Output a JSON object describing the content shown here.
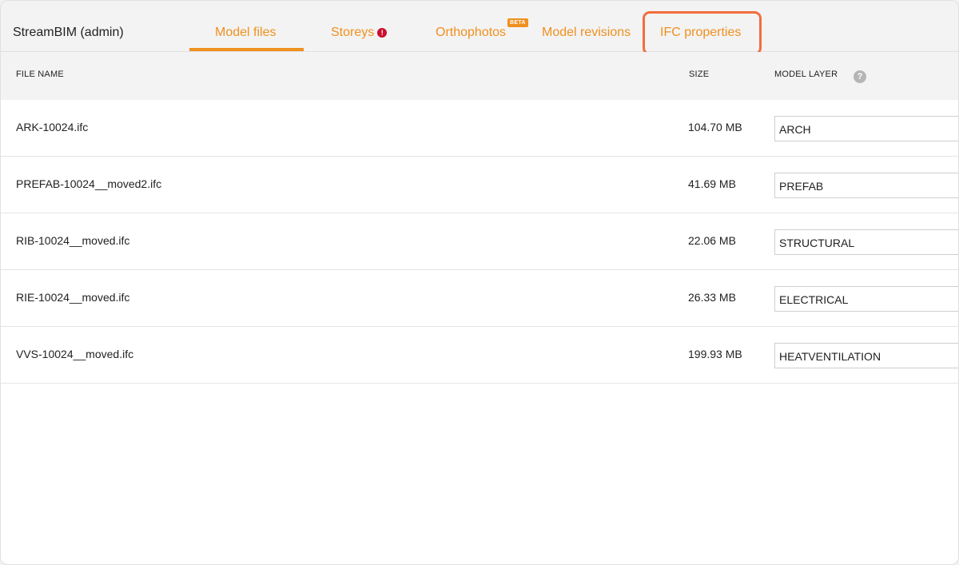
{
  "header": {
    "brand": "StreamBIM (admin)",
    "tabs": [
      {
        "label": "Model files",
        "active": true
      },
      {
        "label": "Storeys",
        "badge_icon": "exclamation-icon"
      },
      {
        "label": "Orthophotos",
        "badge": "BETA"
      },
      {
        "label": "Model revisions"
      },
      {
        "label": "IFC properties",
        "highlighted": true
      }
    ]
  },
  "table": {
    "columns": {
      "file_name": "FILE NAME",
      "size": "SIZE",
      "model_layer": "MODEL LAYER"
    },
    "help_glyph": "?",
    "rows": [
      {
        "file": "ARK-10024.ifc",
        "size": "104.70 MB",
        "layer": "ARCH"
      },
      {
        "file": "PREFAB-10024__moved2.ifc",
        "size": "41.69 MB",
        "layer": "PREFAB"
      },
      {
        "file": "RIB-10024__moved.ifc",
        "size": "22.06 MB",
        "layer": "STRUCTURAL"
      },
      {
        "file": "RIE-10024__moved.ifc",
        "size": "26.33 MB",
        "layer": "ELECTRICAL"
      },
      {
        "file": "VVS-10024__moved.ifc",
        "size": "199.93 MB",
        "layer": "HEATVENTILATION"
      }
    ]
  },
  "colors": {
    "accent": "#f0901e",
    "highlight": "#f26d3d",
    "warning": "#c8102e"
  }
}
